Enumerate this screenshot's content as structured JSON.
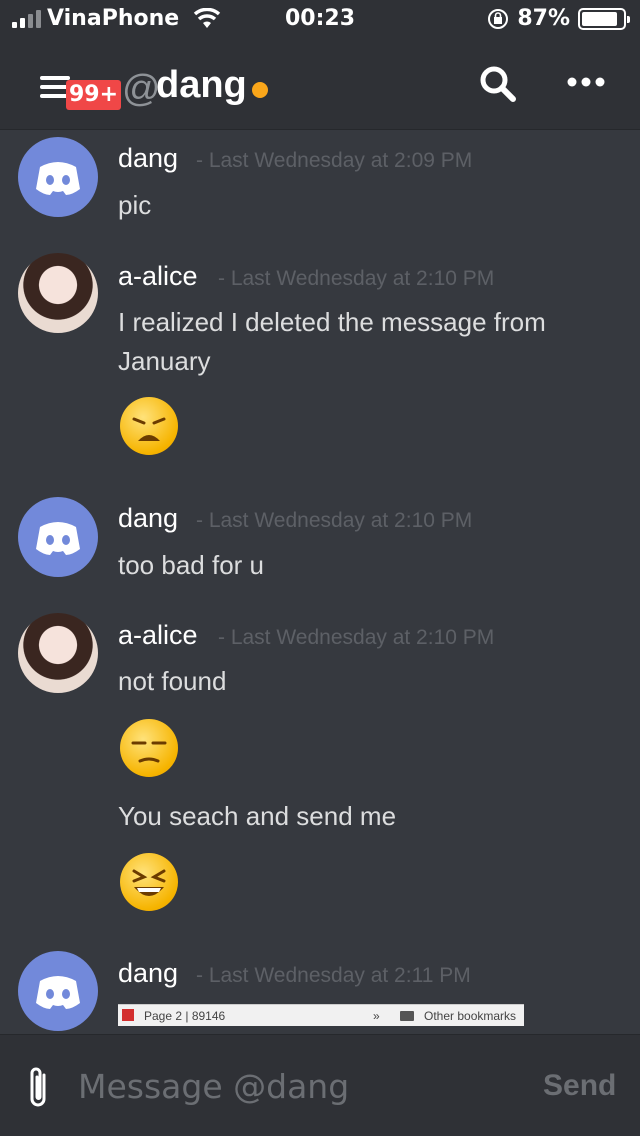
{
  "status_bar": {
    "carrier": "VinaPhone",
    "time": "00:23",
    "battery": "87%",
    "battery_level": 0.87
  },
  "header": {
    "badge": "99+",
    "at_symbol": "@",
    "channel_name": "dang",
    "status_color": "#faa61a"
  },
  "messages": [
    {
      "author": "dang",
      "timestamp": "- Last Wednesday at 2:09 PM",
      "lines": [
        "pic"
      ],
      "avatar": "discord-logo"
    },
    {
      "author": "a-alice",
      "timestamp": "- Last Wednesday at 2:10 PM",
      "lines": [
        "I realized I deleted the message from",
        "January"
      ],
      "emoji": "weary-face",
      "avatar": "profile-photo"
    },
    {
      "author": "dang",
      "timestamp": "- Last Wednesday at 2:10 PM",
      "lines": [
        "too bad for u"
      ],
      "avatar": "discord-logo"
    },
    {
      "author": "a-alice",
      "timestamp": "- Last Wednesday at 2:10 PM",
      "lines": [
        "not found"
      ],
      "emoji": "unamused-face",
      "followup": "You seach and send me",
      "emoji2": "grinning-squinting-face",
      "avatar": "profile-photo"
    },
    {
      "author": "dang",
      "timestamp": "- Last Wednesday at 2:11 PM",
      "avatar": "discord-logo",
      "attachment": {
        "tab_text": "Page 2 | 89146",
        "chevron": "»",
        "bookmarks": "Other bookmarks"
      }
    }
  ],
  "composer": {
    "placeholder": "Message @dang",
    "send_label": "Send"
  },
  "colors": {
    "background": "#36393f",
    "header_bg": "#2f3136",
    "blurple": "#7289da",
    "badge_red": "#f04747"
  }
}
